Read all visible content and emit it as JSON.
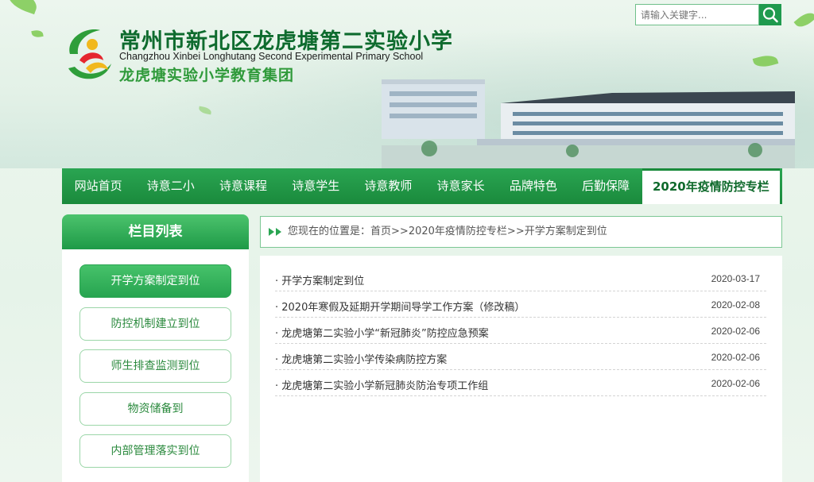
{
  "header": {
    "title_cn": "常州市新北区龙虎塘第二实验小学",
    "title_en": "Changzhou Xinbei Longhutang Second Experimental Primary School",
    "group_name": "龙虎塘实验小学教育集团",
    "search_placeholder": "请输入关键字..."
  },
  "nav": {
    "items": [
      {
        "label": "网站首页"
      },
      {
        "label": "诗意二小"
      },
      {
        "label": "诗意课程"
      },
      {
        "label": "诗意学生"
      },
      {
        "label": "诗意教师"
      },
      {
        "label": "诗意家长"
      },
      {
        "label": "品牌特色"
      },
      {
        "label": "后勤保障"
      },
      {
        "label": "2020年疫情防控专栏"
      }
    ]
  },
  "sidebar": {
    "title": "栏目列表",
    "items": [
      {
        "label": "开学方案制定到位"
      },
      {
        "label": "防控机制建立到位"
      },
      {
        "label": "师生排查监测到位"
      },
      {
        "label": "物资储备到"
      },
      {
        "label": "内部管理落实到位"
      }
    ]
  },
  "breadcrumb": {
    "prefix": "您现在的位置是：",
    "home": "首页",
    "sep1": ">>",
    "section": "2020年疫情防控专栏",
    "sep2": ">>",
    "current": "开学方案制定到位"
  },
  "articles": [
    {
      "title": "开学方案制定到位",
      "date": "2020-03-17"
    },
    {
      "title": "2020年寒假及延期开学期间导学工作方案（修改稿）",
      "date": "2020-02-08"
    },
    {
      "title": "龙虎塘第二实验小学“新冠肺炎”防控应急预案",
      "date": "2020-02-06"
    },
    {
      "title": "龙虎塘第二实验小学传染病防控方案",
      "date": "2020-02-06"
    },
    {
      "title": "龙虎塘第二实验小学新冠肺炎防治专项工作组",
      "date": "2020-02-06"
    }
  ],
  "colors": {
    "brand_green": "#1a8a3c",
    "accent_green": "#2aa552"
  }
}
